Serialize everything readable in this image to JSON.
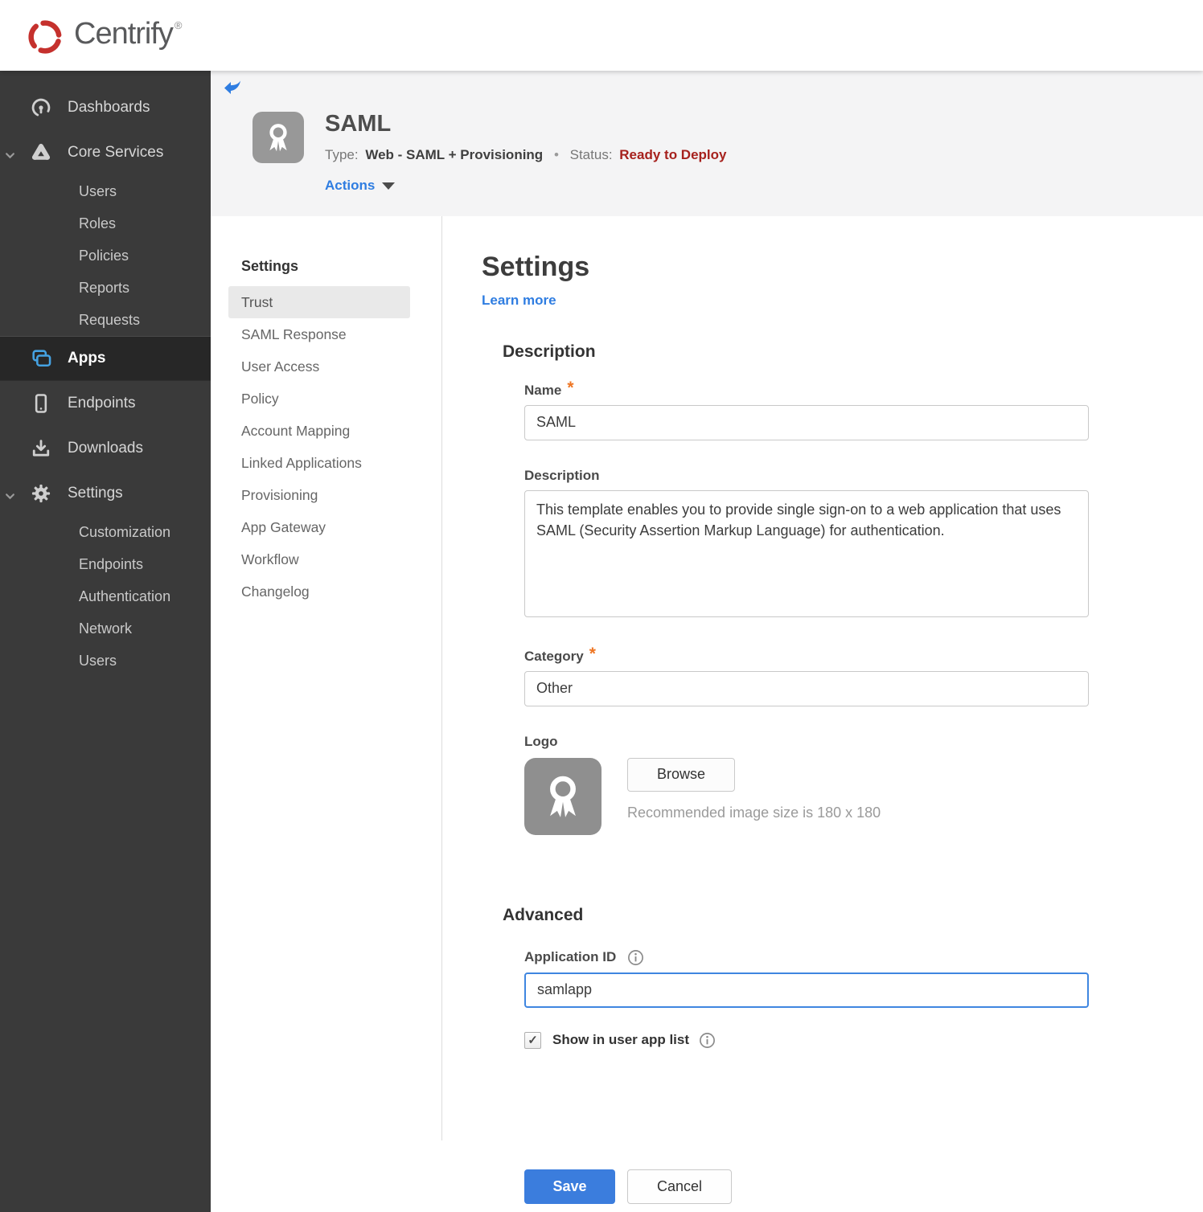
{
  "brand": {
    "name": "Centrify",
    "registered": "®"
  },
  "sidebar": {
    "dashboards": "Dashboards",
    "core_services": "Core Services",
    "core_children": [
      "Users",
      "Roles",
      "Policies",
      "Reports",
      "Requests"
    ],
    "apps": "Apps",
    "endpoints": "Endpoints",
    "downloads": "Downloads",
    "settings": "Settings",
    "settings_children": [
      "Customization",
      "Endpoints",
      "Authentication",
      "Network",
      "Users"
    ]
  },
  "header": {
    "title": "SAML",
    "type_label": "Type:",
    "type_value": "Web - SAML + Provisioning",
    "separator": "•",
    "status_label": "Status:",
    "status_value": "Ready to Deploy",
    "actions": "Actions"
  },
  "subnav": {
    "header": "Settings",
    "selected": "Trust",
    "items": [
      "Trust",
      "SAML Response",
      "User Access",
      "Policy",
      "Account Mapping",
      "Linked Applications",
      "Provisioning",
      "App Gateway",
      "Workflow",
      "Changelog"
    ]
  },
  "main": {
    "title": "Settings",
    "learn_more": "Learn more",
    "required_marker": "*",
    "description": {
      "heading": "Description",
      "name_label": "Name",
      "name_value": "SAML",
      "desc_label": "Description",
      "desc_value": "This template enables you to provide single sign-on to a web application that uses SAML (Security Assertion Markup Language) for authentication.",
      "category_label": "Category",
      "category_value": "Other",
      "logo_label": "Logo",
      "browse": "Browse",
      "logo_hint": "Recommended image size is 180 x 180"
    },
    "advanced": {
      "heading": "Advanced",
      "app_id_label": "Application ID",
      "app_id_value": "samlapp",
      "show_label": "Show in user app list",
      "checked": true,
      "check_glyph": "✓"
    },
    "buttons": {
      "save": "Save",
      "cancel": "Cancel"
    }
  },
  "colors": {
    "accent_blue": "#2f7de1",
    "save_blue": "#3b7ddd",
    "status_red": "#a6211d",
    "apps_icon_blue": "#45a2e2",
    "required_orange": "#ee7624",
    "sidebar_bg": "#3a3a3a",
    "header_bg": "#f4f4f5"
  }
}
